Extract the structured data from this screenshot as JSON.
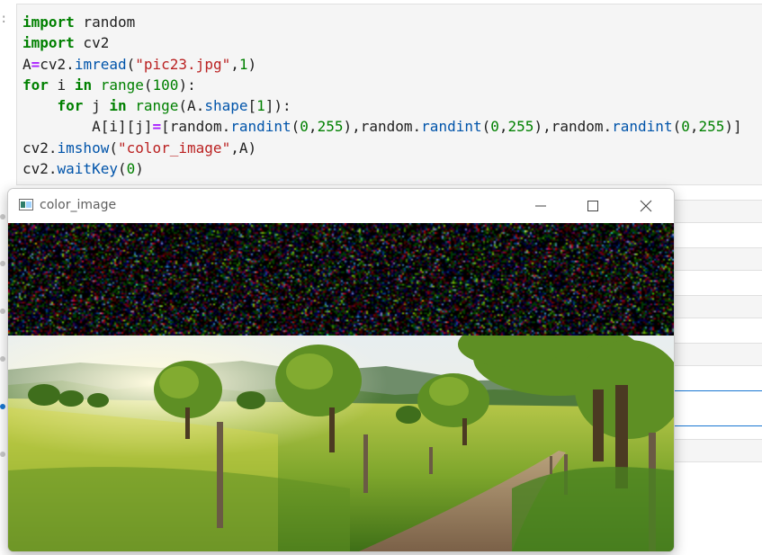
{
  "notebook": {
    "prompt_colon": ":",
    "code": {
      "l1_kw": "import",
      "l1_rest": " random",
      "l2_kw": "import",
      "l2_rest": " cv2",
      "l3_a": "A",
      "l3_eq": "=",
      "l3_mod": "cv2.",
      "l3_fn": "imread",
      "l3_open": "(",
      "l3_str": "\"pic23.jpg\"",
      "l3_comma": ",",
      "l3_num": "1",
      "l3_close": ")",
      "l4_kw1": "for",
      "l4_var": " i ",
      "l4_kw2": "in",
      "l4_sp": " ",
      "l4_fn": "range",
      "l4_open": "(",
      "l4_num": "100",
      "l4_close": "):",
      "l5_indent": "    ",
      "l5_kw1": "for",
      "l5_var": " j ",
      "l5_kw2": "in",
      "l5_sp": " ",
      "l5_fn": "range",
      "l5_open": "(A.",
      "l5_attr": "shape",
      "l5_idx_open": "[",
      "l5_num": "1",
      "l5_close": "]):",
      "l6_indent": "        ",
      "l6_lhs": "A[i][j]",
      "l6_eq": "=",
      "l6_b": "[random.",
      "l6_fn1": "randint",
      "l6_o1": "(",
      "l6_n1a": "0",
      "l6_c1": ",",
      "l6_n1b": "255",
      "l6_p1": "),random.",
      "l6_fn2": "randint",
      "l6_o2": "(",
      "l6_n2a": "0",
      "l6_c2": ",",
      "l6_n2b": "255",
      "l6_p2": "),random.",
      "l6_fn3": "randint",
      "l6_o3": "(",
      "l6_n3a": "0",
      "l6_c3": ",",
      "l6_n3b": "255",
      "l6_p3": ")]",
      "l7_mod": "cv2.",
      "l7_fn": "imshow",
      "l7_open": "(",
      "l7_str": "\"color_image\"",
      "l7_rest": ",A)",
      "l8_mod": "cv2.",
      "l8_fn": "waitKey",
      "l8_open": "(",
      "l8_num": "0",
      "l8_close": ")"
    }
  },
  "window": {
    "title": "color_image",
    "controls": [
      "minimize-icon",
      "maximize-icon",
      "close-icon"
    ],
    "image": {
      "noise_rows": 100,
      "description_content": "random-color-noise-band-over-landscape-photo"
    }
  },
  "colors": {
    "keyword": "#008000",
    "string": "#ba2121",
    "function": "#0054aa",
    "operator": "#aa22ff",
    "cell_bg": "#f5f5f5",
    "selection": "#1976d2"
  }
}
